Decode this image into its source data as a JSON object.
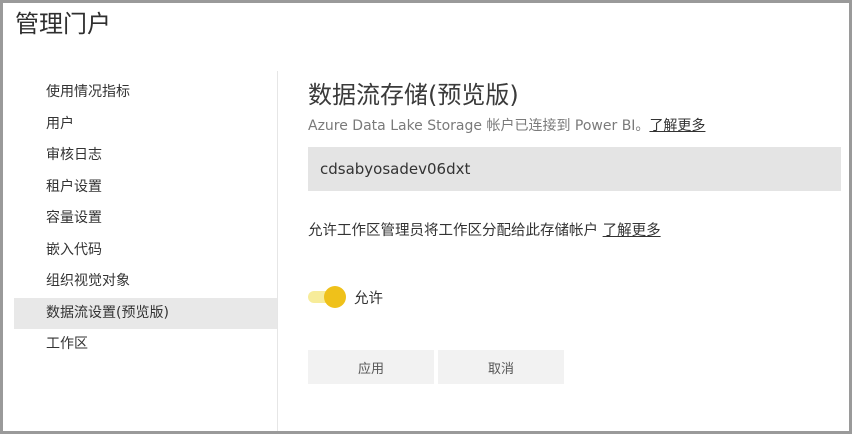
{
  "header": {
    "title": "管理门户"
  },
  "sidebar": {
    "items": [
      {
        "label": "使用情况指标",
        "active": false
      },
      {
        "label": "用户",
        "active": false
      },
      {
        "label": "审核日志",
        "active": false
      },
      {
        "label": "租户设置",
        "active": false
      },
      {
        "label": "容量设置",
        "active": false
      },
      {
        "label": "嵌入代码",
        "active": false
      },
      {
        "label": "组织视觉对象",
        "active": false
      },
      {
        "label": "数据流设置(预览版)",
        "active": true
      },
      {
        "label": "工作区",
        "active": false
      }
    ]
  },
  "main": {
    "title": "数据流存储(预览版)",
    "subtitle": "Azure Data Lake Storage 帐户已连接到 Power BI。",
    "subtitle_link": "了解更多",
    "account_name": "cdsabyosadev06dxt",
    "permission_text": "允许工作区管理员将工作区分配给此存储帐户",
    "permission_link": "了解更多",
    "toggle": {
      "label": "允许",
      "on": true,
      "track_color": "#f7ec9a",
      "knob_color": "#efc11a"
    },
    "apply_label": "应用",
    "cancel_label": "取消"
  }
}
